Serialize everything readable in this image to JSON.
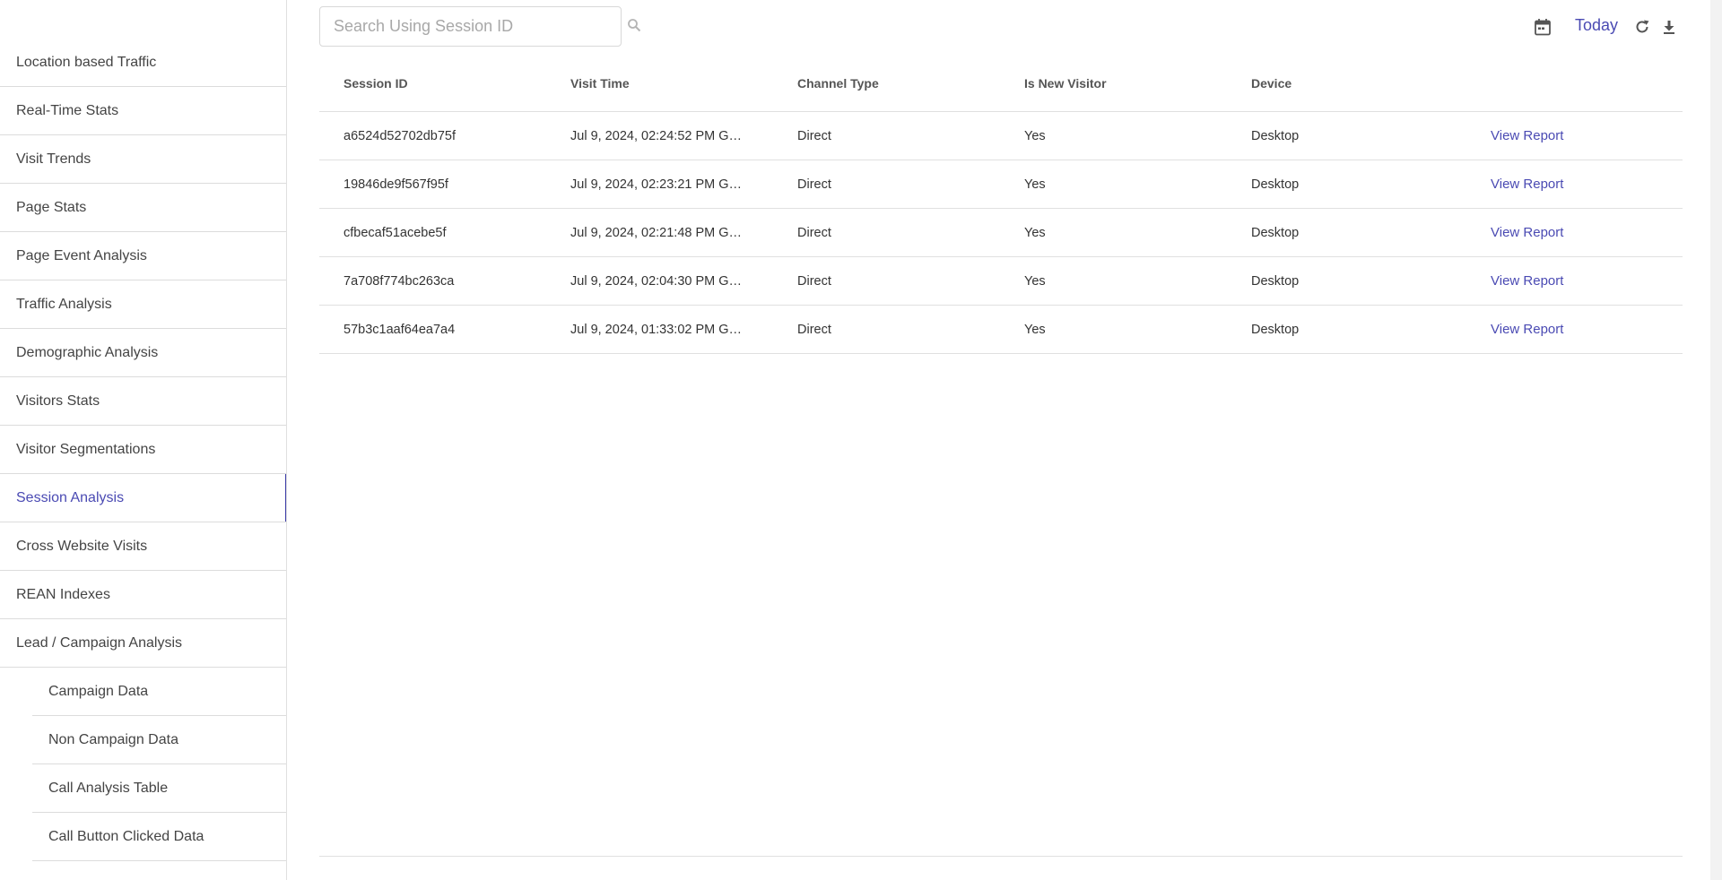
{
  "sidebar": {
    "items": [
      {
        "label": "Location based Traffic"
      },
      {
        "label": "Real-Time Stats"
      },
      {
        "label": "Visit Trends"
      },
      {
        "label": "Page Stats"
      },
      {
        "label": "Page Event Analysis"
      },
      {
        "label": "Traffic Analysis"
      },
      {
        "label": "Demographic Analysis"
      },
      {
        "label": "Visitors Stats"
      },
      {
        "label": "Visitor Segmentations"
      },
      {
        "label": "Session Analysis"
      },
      {
        "label": "Cross Website Visits"
      },
      {
        "label": "REAN Indexes"
      },
      {
        "label": "Lead / Campaign Analysis"
      }
    ],
    "sub_items": [
      {
        "label": "Campaign Data"
      },
      {
        "label": "Non Campaign Data"
      },
      {
        "label": "Call Analysis Table"
      },
      {
        "label": "Call Button Clicked Data"
      }
    ],
    "active_label": "Session Analysis",
    "accent_color": "#3d3da8"
  },
  "search": {
    "placeholder": "Search Using Session ID",
    "value": ""
  },
  "toolbar": {
    "date_range_label": "Today",
    "icons": [
      "calendar-icon",
      "refresh-icon",
      "download-icon"
    ]
  },
  "table": {
    "columns": [
      "Session ID",
      "Visit Time",
      "Channel Type",
      "Is New Visitor",
      "Device"
    ],
    "rows": [
      {
        "session_id": "a6524d52702db75f",
        "visit_time": "Jul 9, 2024, 02:24:52 PM GM...",
        "channel": "Direct",
        "new_visitor": "Yes",
        "device": "Desktop",
        "action": "View Report"
      },
      {
        "session_id": "19846de9f567f95f",
        "visit_time": "Jul 9, 2024, 02:23:21 PM GM...",
        "channel": "Direct",
        "new_visitor": "Yes",
        "device": "Desktop",
        "action": "View Report"
      },
      {
        "session_id": "cfbecaf51acebe5f",
        "visit_time": "Jul 9, 2024, 02:21:48 PM GM...",
        "channel": "Direct",
        "new_visitor": "Yes",
        "device": "Desktop",
        "action": "View Report"
      },
      {
        "session_id": "7a708f774bc263ca",
        "visit_time": "Jul 9, 2024, 02:04:30 PM GM...",
        "channel": "Direct",
        "new_visitor": "Yes",
        "device": "Desktop",
        "action": "View Report"
      },
      {
        "session_id": "57b3c1aaf64ea7a4",
        "visit_time": "Jul 9, 2024, 01:33:02 PM GM...",
        "channel": "Direct",
        "new_visitor": "Yes",
        "device": "Desktop",
        "action": "View Report"
      }
    ]
  },
  "colors": {
    "link": "#4a4ab3",
    "border": "#e0e0e0"
  }
}
